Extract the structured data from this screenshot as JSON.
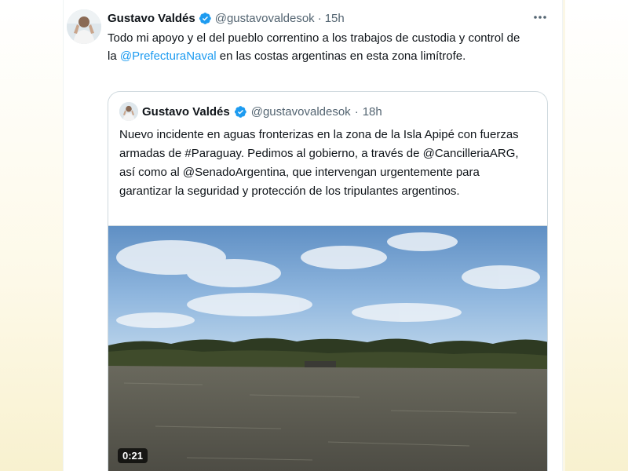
{
  "tweet": {
    "author_name": "Gustavo Valdés",
    "handle": "@gustavovaldesok",
    "separator": "·",
    "time": "15h",
    "more_icon": "more-horizontal-icon",
    "text_before": "Todo mi apoyo y el del pueblo correntino a los trabajos de custodia y control de la ",
    "mention": "@PrefecturaNaval",
    "text_after": " en las costas argentinas en esta zona limítrofe."
  },
  "quote": {
    "author_name": "Gustavo Valdés",
    "handle": "@gustavovaldesok",
    "separator": "·",
    "time": "18h",
    "text": "Nuevo incidente en aguas fronterizas en la zona de la Isla Apipé con fuerzas armadas de #Paraguay. Pedimos al gobierno, a través de @CancilleriaARG, así como al @SenadoArgentina, que intervengan urgentemente para garantizar la seguridad y protección de los tripulantes argentinos.",
    "video_duration": "0:21"
  },
  "colors": {
    "link": "#1d9bf0",
    "verified": "#1d9bf0",
    "secondary_text": "#536471"
  }
}
